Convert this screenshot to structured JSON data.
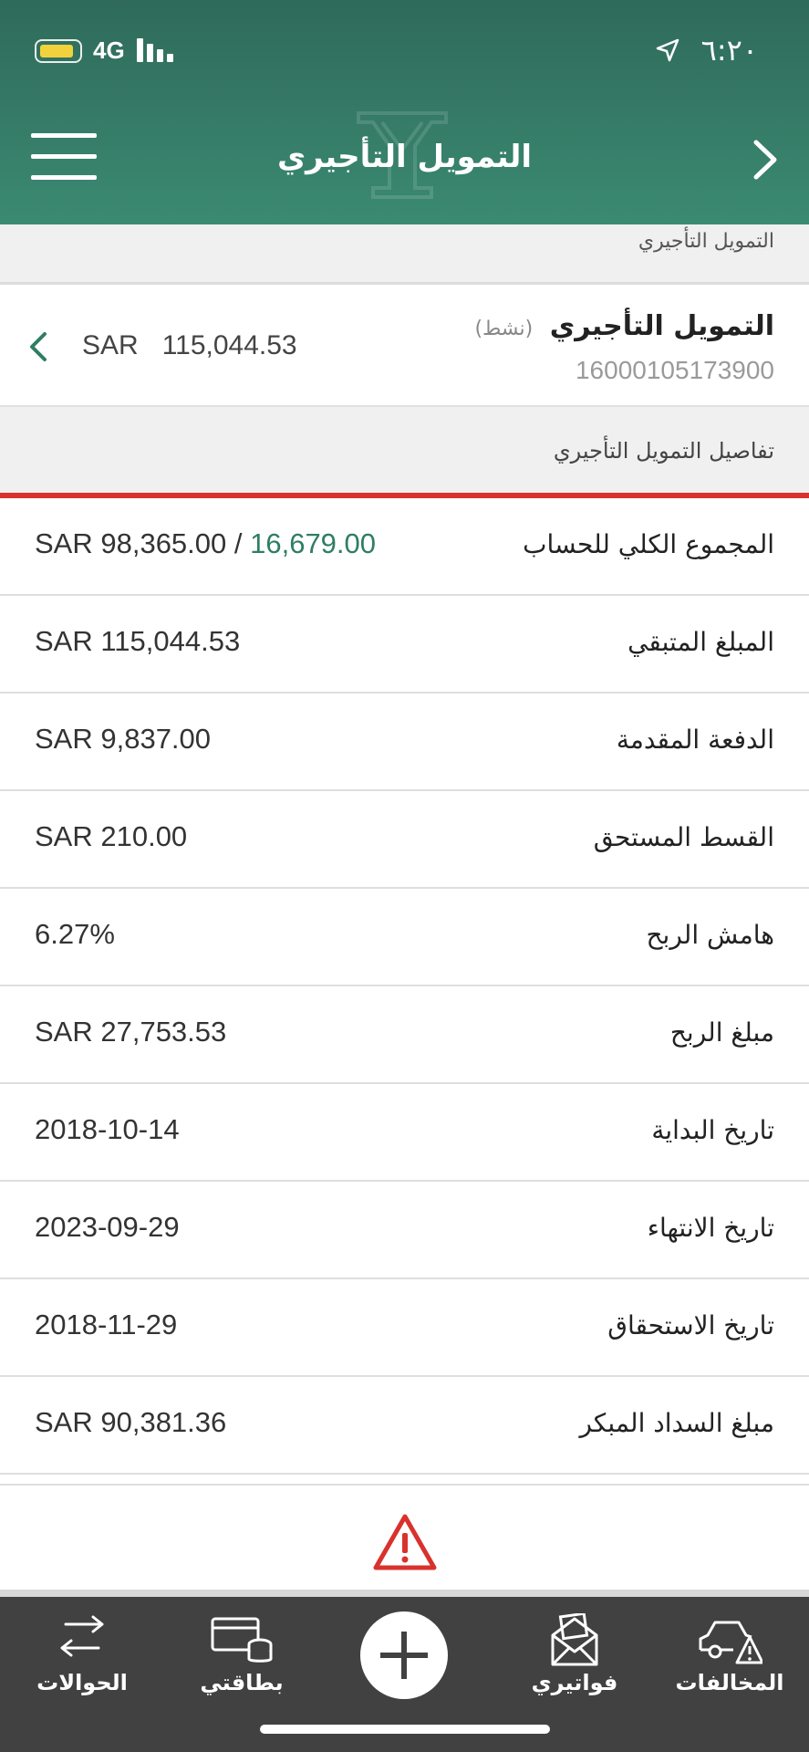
{
  "status_bar": {
    "network": "4G",
    "time": "٦:٢٠"
  },
  "header": {
    "title": "التمويل التأجيري"
  },
  "breadcrumb": {
    "text": "التمويل التأجيري"
  },
  "account": {
    "title": "التمويل التأجيري",
    "status": "(نشط)",
    "number": "16000105173900",
    "currency": "SAR",
    "balance": "115,044.53"
  },
  "section": {
    "title": "تفاصيل التمويل التأجيري"
  },
  "details": [
    {
      "label": "المجموع الكلي للحساب",
      "value_prefix": "SAR 98,365.00 / ",
      "value_accent": "16,679.00"
    },
    {
      "label": "المبلغ المتبقي",
      "value": "SAR 115,044.53"
    },
    {
      "label": "الدفعة المقدمة",
      "value": "SAR 9,837.00"
    },
    {
      "label": "القسط المستحق",
      "value": "SAR 210.00"
    },
    {
      "label": "هامش الربح",
      "value": "6.27%"
    },
    {
      "label": "مبلغ الربح",
      "value": "SAR 27,753.53"
    },
    {
      "label": "تاريخ البداية",
      "value": "2018-10-14"
    },
    {
      "label": "تاريخ الانتهاء",
      "value": "2023-09-29"
    },
    {
      "label": "تاريخ الاستحقاق",
      "value": "2018-11-29"
    },
    {
      "label": "مبلغ السداد المبكر",
      "value": "SAR 90,381.36"
    }
  ],
  "tabbar": {
    "transfers": "الحوالات",
    "cards": "بطاقتي",
    "bills": "فواتيري",
    "violations": "المخالفات"
  },
  "icons": {
    "menu": "hamburger-icon",
    "back": "chevron-right-icon",
    "expand": "chevron-left-icon",
    "warning": "warning-triangle-icon",
    "add": "plus-icon"
  },
  "colors": {
    "header": "#3b8a72",
    "accent_value": "#2f7e62",
    "section_rule": "#d9322d",
    "tabbar": "#414141"
  }
}
